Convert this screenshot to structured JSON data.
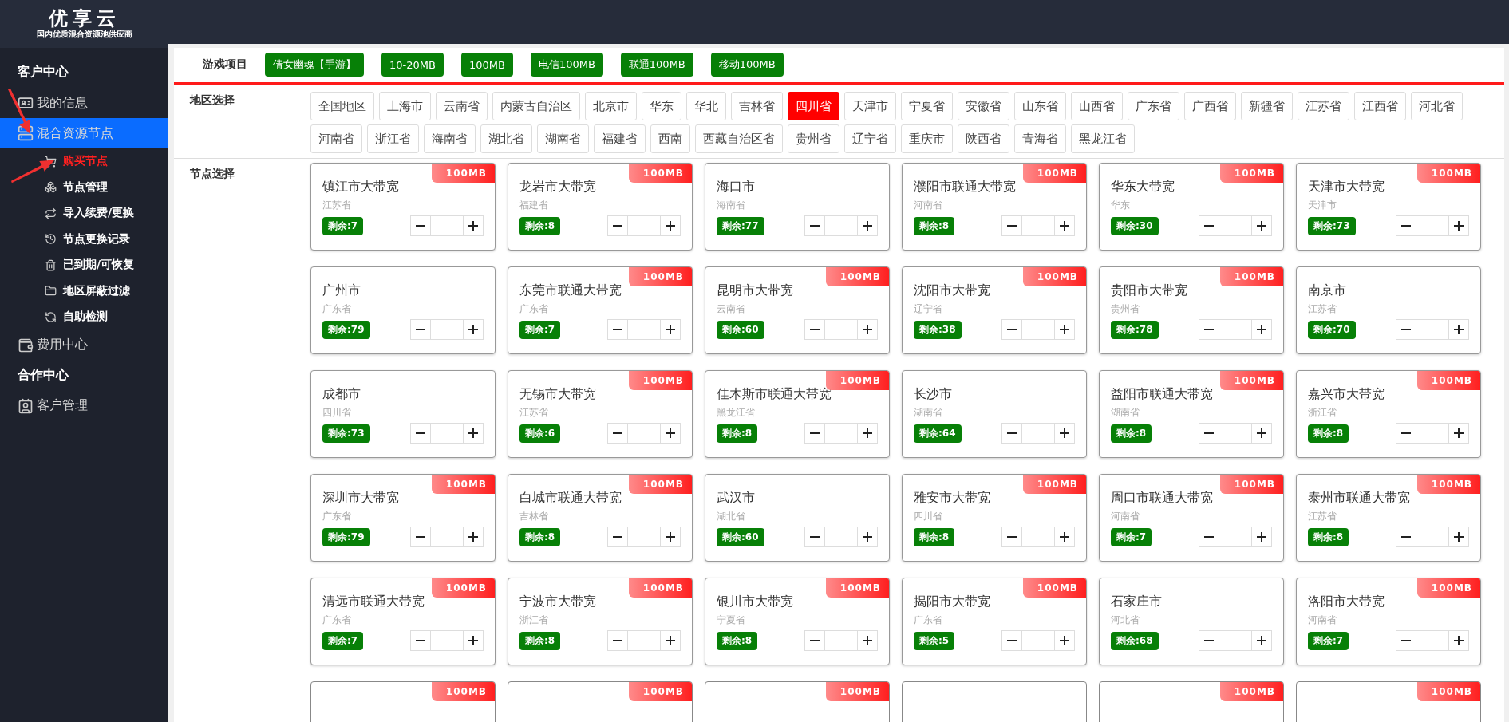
{
  "logo": {
    "title": "优享云",
    "subtitle": "国内优质混合资源池供应商"
  },
  "sidebar": {
    "sections": [
      {
        "kind": "heading",
        "label": "客户中心"
      },
      {
        "kind": "item",
        "label": "我的信息",
        "selected": false
      },
      {
        "kind": "item",
        "label": "混合资源节点",
        "selected": true,
        "children": [
          {
            "label": "购买节点",
            "selected": true
          },
          {
            "label": "节点管理",
            "selected": false
          },
          {
            "label": "导入续费/更换",
            "selected": false
          },
          {
            "label": "节点更换记录",
            "selected": false
          },
          {
            "label": "已到期/可恢复",
            "selected": false
          },
          {
            "label": "地区屏蔽过滤",
            "selected": false
          },
          {
            "label": "自助检测",
            "selected": false
          }
        ]
      },
      {
        "kind": "item",
        "label": "费用中心",
        "selected": false
      },
      {
        "kind": "heading",
        "label": "合作中心"
      },
      {
        "kind": "item",
        "label": "客户管理",
        "selected": false
      }
    ]
  },
  "game": {
    "label": "游戏项目",
    "tags": [
      "倩女幽魂【手游】",
      "10-20MB",
      "100MB",
      "电信100MB",
      "联通100MB",
      "移动100MB"
    ]
  },
  "regions": {
    "label": "地区选择",
    "items": [
      {
        "label": "全国地区",
        "selected": false
      },
      {
        "label": "上海市",
        "selected": false
      },
      {
        "label": "云南省",
        "selected": false
      },
      {
        "label": "内蒙古自治区",
        "selected": false
      },
      {
        "label": "北京市",
        "selected": false
      },
      {
        "label": "华东",
        "selected": false
      },
      {
        "label": "华北",
        "selected": false
      },
      {
        "label": "吉林省",
        "selected": false
      },
      {
        "label": "四川省",
        "selected": true
      },
      {
        "label": "天津市",
        "selected": false
      },
      {
        "label": "宁夏省",
        "selected": false
      },
      {
        "label": "安徽省",
        "selected": false
      },
      {
        "label": "山东省",
        "selected": false
      },
      {
        "label": "山西省",
        "selected": false
      },
      {
        "label": "广东省",
        "selected": false
      },
      {
        "label": "广西省",
        "selected": false
      },
      {
        "label": "新疆省",
        "selected": false
      },
      {
        "label": "江苏省",
        "selected": false
      },
      {
        "label": "江西省",
        "selected": false
      },
      {
        "label": "河北省",
        "selected": false
      },
      {
        "label": "河南省",
        "selected": false
      },
      {
        "label": "浙江省",
        "selected": false
      },
      {
        "label": "海南省",
        "selected": false
      },
      {
        "label": "湖北省",
        "selected": false
      },
      {
        "label": "湖南省",
        "selected": false
      },
      {
        "label": "福建省",
        "selected": false
      },
      {
        "label": "西南",
        "selected": false
      },
      {
        "label": "西藏自治区省",
        "selected": false
      },
      {
        "label": "贵州省",
        "selected": false
      },
      {
        "label": "辽宁省",
        "selected": false
      },
      {
        "label": "重庆市",
        "selected": false
      },
      {
        "label": "陕西省",
        "selected": false
      },
      {
        "label": "青海省",
        "selected": false
      },
      {
        "label": "黑龙江省",
        "selected": false
      }
    ]
  },
  "nodes": {
    "label": "节点选择",
    "cards": [
      {
        "title": "镇江市大带宽",
        "region": "江苏省",
        "remain": "剩余:7",
        "badge": "100MB"
      },
      {
        "title": "龙岩市大带宽",
        "region": "福建省",
        "remain": "剩余:8",
        "badge": "100MB"
      },
      {
        "title": "海口市",
        "region": "海南省",
        "remain": "剩余:77"
      },
      {
        "title": "濮阳市联通大带宽",
        "region": "河南省",
        "remain": "剩余:8",
        "badge": "100MB"
      },
      {
        "title": "华东大带宽",
        "region": "华东",
        "remain": "剩余:30",
        "badge": "100MB"
      },
      {
        "title": "天津市大带宽",
        "region": "天津市",
        "remain": "剩余:73",
        "badge": "100MB"
      },
      {
        "title": "广州市",
        "region": "广东省",
        "remain": "剩余:79"
      },
      {
        "title": "东莞市联通大带宽",
        "region": "广东省",
        "remain": "剩余:7",
        "badge": "100MB"
      },
      {
        "title": "昆明市大带宽",
        "region": "云南省",
        "remain": "剩余:60",
        "badge": "100MB"
      },
      {
        "title": "沈阳市大带宽",
        "region": "辽宁省",
        "remain": "剩余:38",
        "badge": "100MB"
      },
      {
        "title": "贵阳市大带宽",
        "region": "贵州省",
        "remain": "剩余:78",
        "badge": "100MB"
      },
      {
        "title": "南京市",
        "region": "江苏省",
        "remain": "剩余:70"
      },
      {
        "title": "成都市",
        "region": "四川省",
        "remain": "剩余:73"
      },
      {
        "title": "无锡市大带宽",
        "region": "江苏省",
        "remain": "剩余:6",
        "badge": "100MB"
      },
      {
        "title": "佳木斯市联通大带宽",
        "region": "黑龙江省",
        "remain": "剩余:8",
        "badge": "100MB"
      },
      {
        "title": "长沙市",
        "region": "湖南省",
        "remain": "剩余:64"
      },
      {
        "title": "益阳市联通大带宽",
        "region": "湖南省",
        "remain": "剩余:8",
        "badge": "100MB"
      },
      {
        "title": "嘉兴市大带宽",
        "region": "浙江省",
        "remain": "剩余:8",
        "badge": "100MB"
      },
      {
        "title": "深圳市大带宽",
        "region": "广东省",
        "remain": "剩余:79",
        "badge": "100MB"
      },
      {
        "title": "白城市联通大带宽",
        "region": "吉林省",
        "remain": "剩余:8",
        "badge": "100MB"
      },
      {
        "title": "武汉市",
        "region": "湖北省",
        "remain": "剩余:60"
      },
      {
        "title": "雅安市大带宽",
        "region": "四川省",
        "remain": "剩余:8",
        "badge": "100MB"
      },
      {
        "title": "周口市联通大带宽",
        "region": "河南省",
        "remain": "剩余:7",
        "badge": "100MB"
      },
      {
        "title": "泰州市联通大带宽",
        "region": "江苏省",
        "remain": "剩余:8",
        "badge": "100MB"
      },
      {
        "title": "清远市联通大带宽",
        "region": "广东省",
        "remain": "剩余:7",
        "badge": "100MB"
      },
      {
        "title": "宁波市大带宽",
        "region": "浙江省",
        "remain": "剩余:8",
        "badge": "100MB"
      },
      {
        "title": "银川市大带宽",
        "region": "宁夏省",
        "remain": "剩余:8",
        "badge": "100MB"
      },
      {
        "title": "揭阳市大带宽",
        "region": "广东省",
        "remain": "剩余:5",
        "badge": "100MB"
      },
      {
        "title": "石家庄市",
        "region": "河北省",
        "remain": "剩余:68"
      },
      {
        "title": "洛阳市大带宽",
        "region": "河南省",
        "remain": "剩余:7",
        "badge": "100MB"
      },
      {
        "kind": "cut",
        "badge": "100MB"
      },
      {
        "kind": "cut",
        "badge": "100MB"
      },
      {
        "kind": "cut",
        "badge": "100MB"
      },
      {
        "kind": "cut"
      },
      {
        "kind": "cut",
        "badge": "100MB"
      },
      {
        "kind": "cut",
        "badge": "100MB"
      }
    ]
  }
}
